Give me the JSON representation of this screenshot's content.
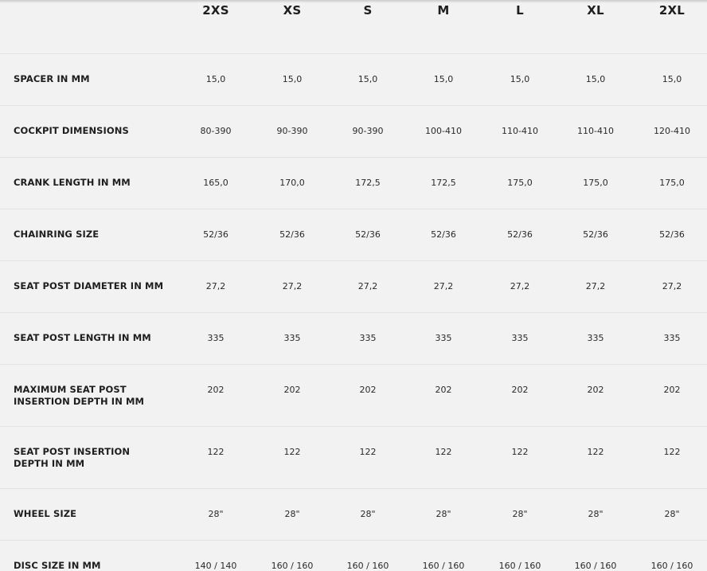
{
  "sizes": [
    "2XS",
    "XS",
    "S",
    "M",
    "L",
    "XL",
    "2XL"
  ],
  "rows": [
    {
      "label": "SPACER IN MM",
      "values": [
        "15,0",
        "15,0",
        "15,0",
        "15,0",
        "15,0",
        "15,0",
        "15,0"
      ]
    },
    {
      "label": "COCKPIT DIMENSIONS",
      "values": [
        "80-390",
        "90-390",
        "90-390",
        "100-410",
        "110-410",
        "110-410",
        "120-410"
      ]
    },
    {
      "label": "CRANK LENGTH IN MM",
      "values": [
        "165,0",
        "170,0",
        "172,5",
        "172,5",
        "175,0",
        "175,0",
        "175,0"
      ]
    },
    {
      "label": "CHAINRING SIZE",
      "values": [
        "52/36",
        "52/36",
        "52/36",
        "52/36",
        "52/36",
        "52/36",
        "52/36"
      ]
    },
    {
      "label": "SEAT POST DIAMETER IN MM",
      "values": [
        "27,2",
        "27,2",
        "27,2",
        "27,2",
        "27,2",
        "27,2",
        "27,2"
      ]
    },
    {
      "label": "SEAT POST LENGTH IN MM",
      "values": [
        "335",
        "335",
        "335",
        "335",
        "335",
        "335",
        "335"
      ]
    },
    {
      "label": "MAXIMUM SEAT POST INSERTION DEPTH IN MM",
      "values": [
        "202",
        "202",
        "202",
        "202",
        "202",
        "202",
        "202"
      ]
    },
    {
      "label": "SEAT POST INSERTION DEPTH IN MM",
      "values": [
        "122",
        "122",
        "122",
        "122",
        "122",
        "122",
        "122"
      ]
    },
    {
      "label": "WHEEL SIZE",
      "values": [
        "28\"",
        "28\"",
        "28\"",
        "28\"",
        "28\"",
        "28\"",
        "28\""
      ]
    },
    {
      "label": "DISC SIZE IN MM",
      "values": [
        "140 / 140",
        "160 / 160",
        "160 / 160",
        "160 / 160",
        "160 / 160",
        "160 / 160",
        "160 / 160"
      ]
    }
  ]
}
